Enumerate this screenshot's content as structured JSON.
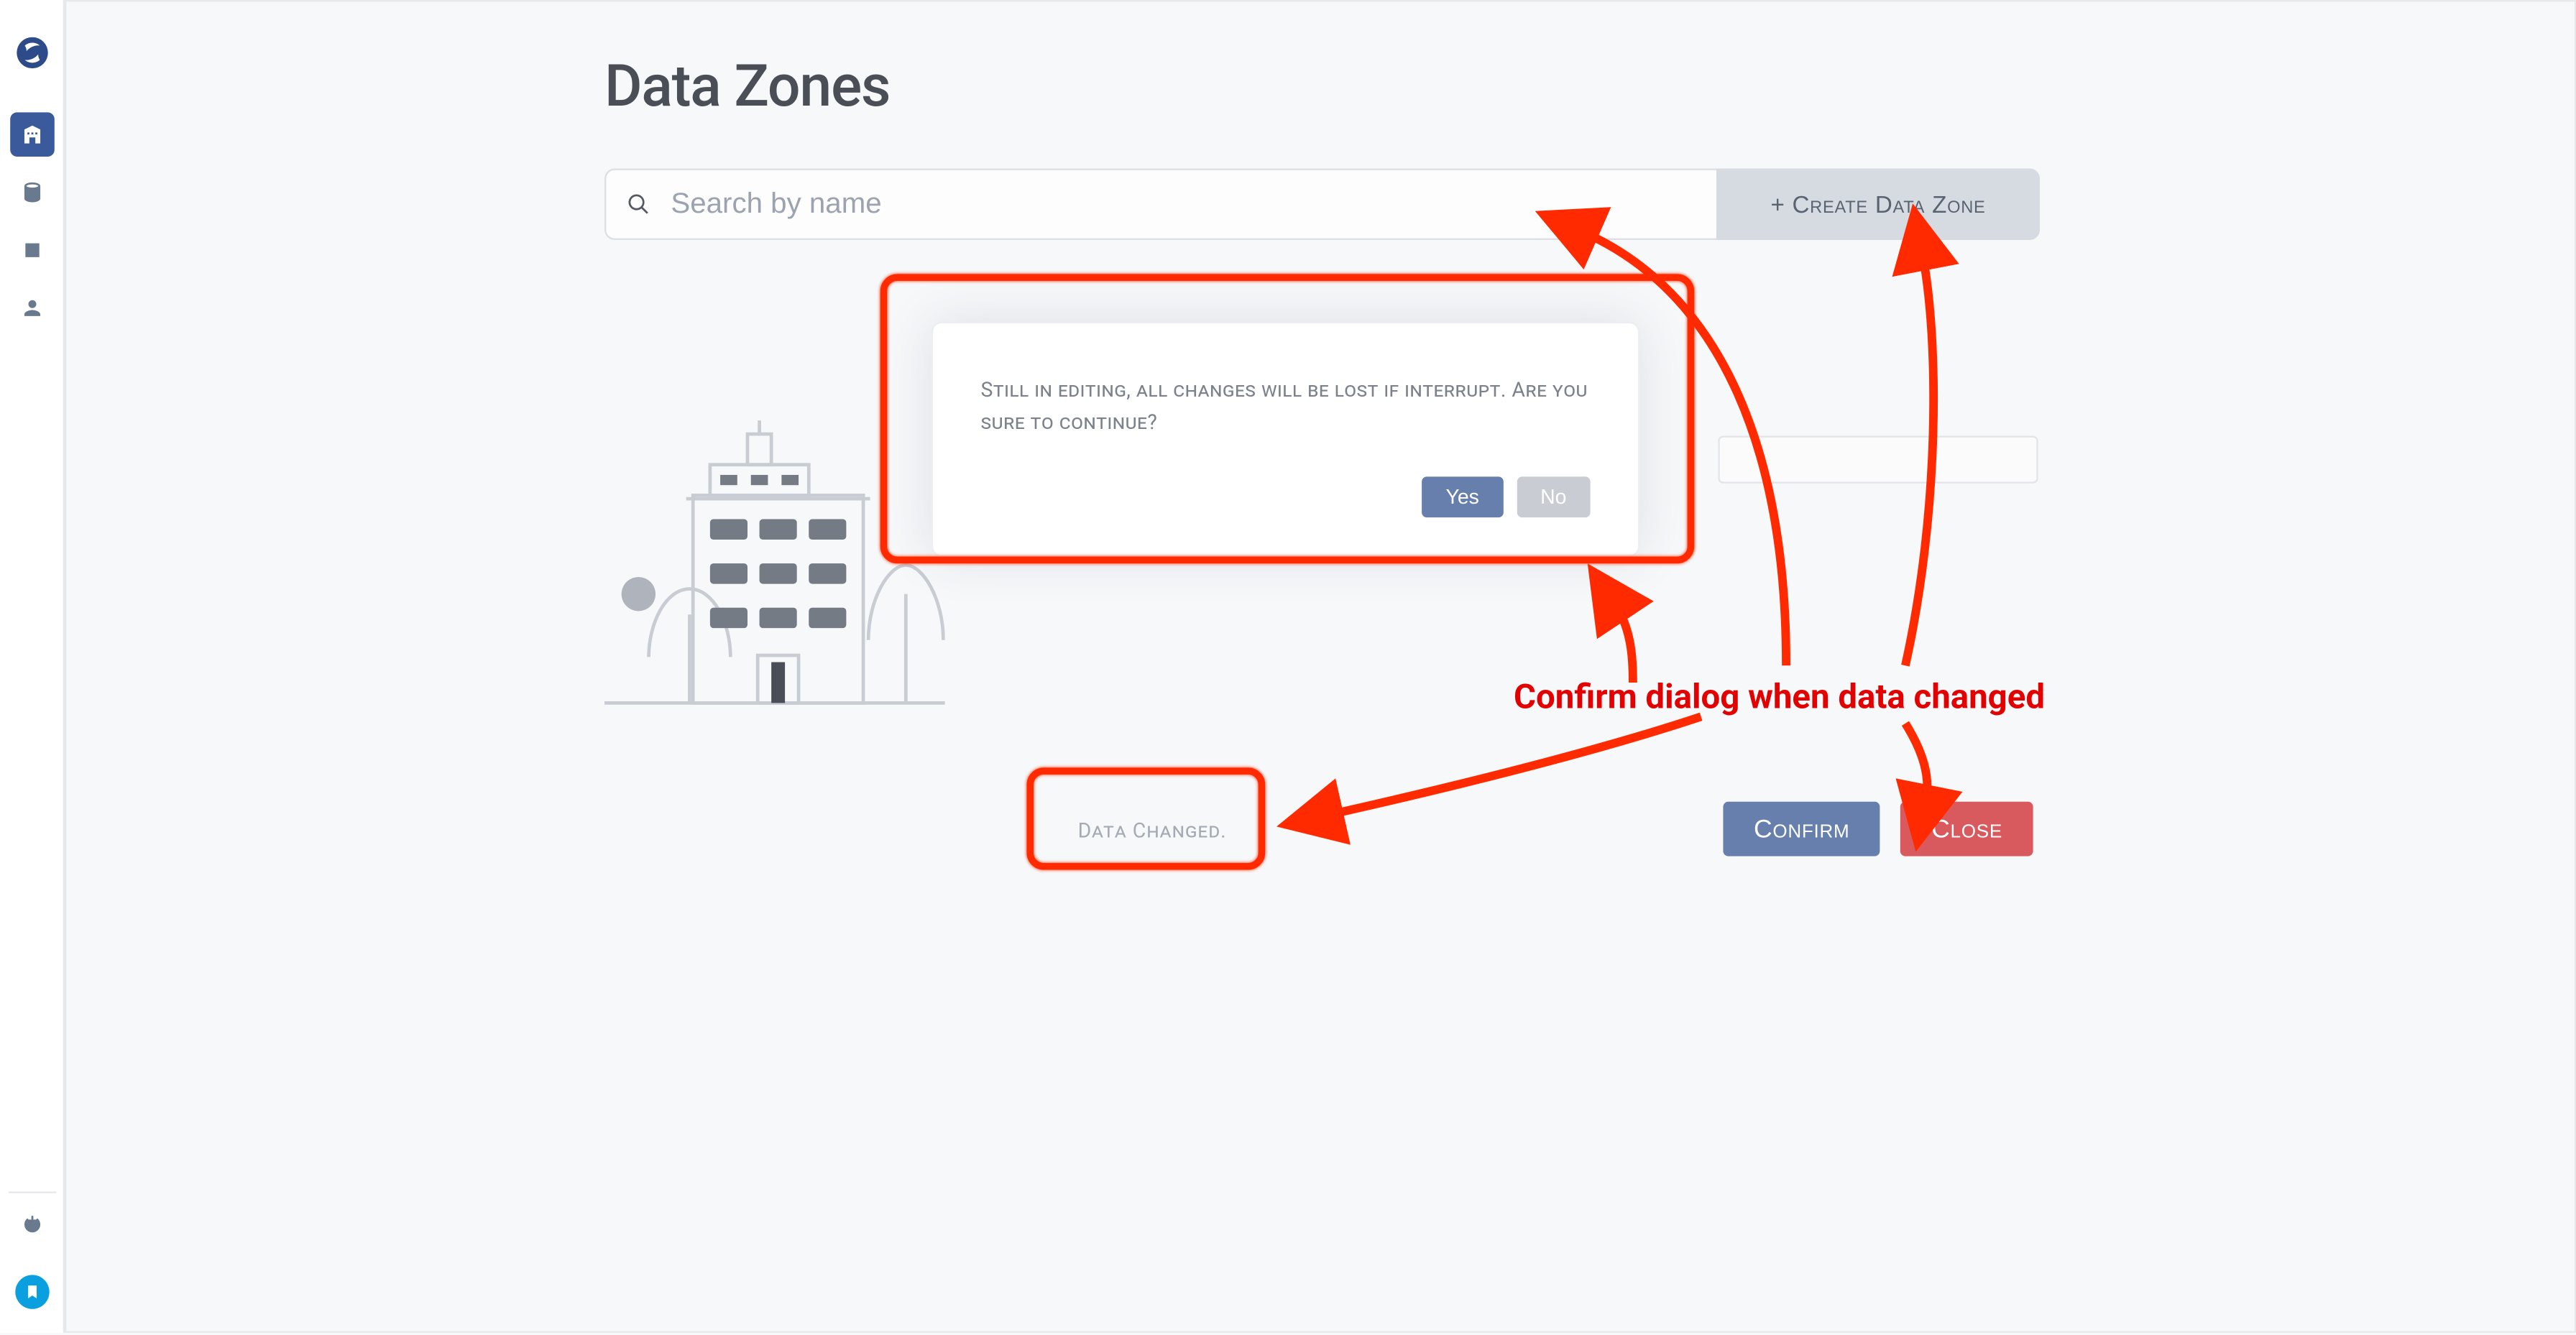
{
  "page": {
    "title": "Data Zones"
  },
  "search": {
    "placeholder": "Search by name"
  },
  "actions": {
    "create": "+ Create Data Zone"
  },
  "dialog": {
    "message": "Still in editing, all changes will be lost if interrupt. Are you sure to continue?",
    "yes": "Yes",
    "no": "No"
  },
  "status": {
    "changed": "Data Changed."
  },
  "footer": {
    "confirm": "Confirm",
    "close": "Close"
  },
  "annotation": {
    "label": "Confirm dialog when data changed"
  },
  "sidebar": {
    "items": [
      {
        "name": "data-zones",
        "active": true
      },
      {
        "name": "database",
        "active": false
      },
      {
        "name": "external",
        "active": false
      },
      {
        "name": "user",
        "active": false
      }
    ]
  }
}
